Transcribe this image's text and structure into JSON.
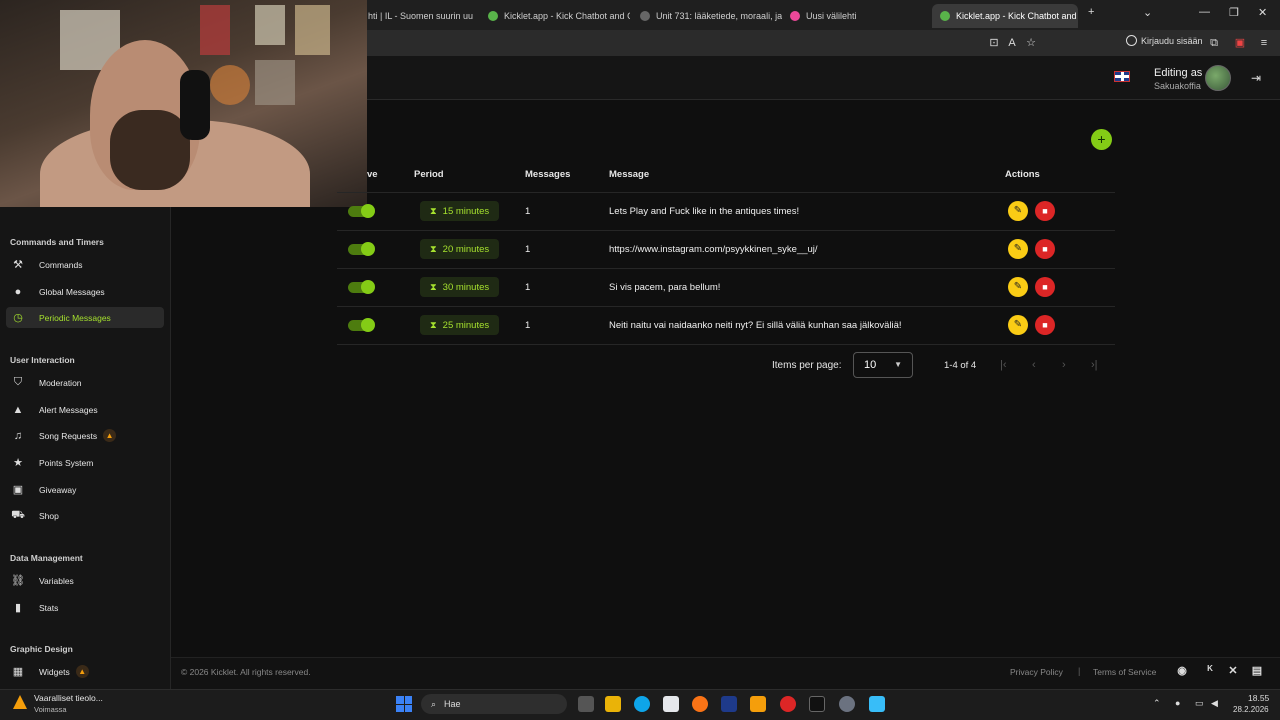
{
  "browser": {
    "tabs": [
      {
        "label": "hti | IL - Suomen suurin uu"
      },
      {
        "label": "Kicklet.app - Kick Chatbot and C"
      },
      {
        "label": "Unit 731: lääketiede, moraali, ja"
      },
      {
        "label": "Uusi välilehti"
      },
      {
        "label": "Kicklet.app - Kick Chatbot and C"
      }
    ],
    "login_label": "Kirjaudu sisään"
  },
  "header": {
    "editing_as": "Editing as",
    "username": "Sakuakoffia"
  },
  "sidebar": {
    "sections": [
      {
        "title": "Commands and Timers",
        "items": [
          {
            "label": "Commands",
            "icon": "hammer-icon"
          },
          {
            "label": "Global Messages",
            "icon": "chat-bubble-icon"
          },
          {
            "label": "Periodic Messages",
            "icon": "clock-icon",
            "active": true
          }
        ]
      },
      {
        "title": "User Interaction",
        "items": [
          {
            "label": "Moderation",
            "icon": "shield-icon"
          },
          {
            "label": "Alert Messages",
            "icon": "warning-icon"
          },
          {
            "label": "Song Requests",
            "icon": "music-note-icon",
            "badge": "fire"
          },
          {
            "label": "Points System",
            "icon": "star-icon"
          },
          {
            "label": "Giveaway",
            "icon": "gift-icon"
          },
          {
            "label": "Shop",
            "icon": "cart-icon"
          }
        ]
      },
      {
        "title": "Data Management",
        "items": [
          {
            "label": "Variables",
            "icon": "link-icon"
          },
          {
            "label": "Stats",
            "icon": "bar-chart-icon"
          }
        ]
      },
      {
        "title": "Graphic Design",
        "items": [
          {
            "label": "Widgets",
            "icon": "widgets-icon",
            "badge": "fire"
          }
        ]
      }
    ]
  },
  "table": {
    "columns": {
      "active": "ve",
      "period": "Period",
      "messages": "Messages",
      "message": "Message",
      "actions": "Actions"
    },
    "rows": [
      {
        "active": true,
        "period": "15 minutes",
        "messages": "1",
        "message": "Lets Play and Fuck like in the antiques times!"
      },
      {
        "active": true,
        "period": "20 minutes",
        "messages": "1",
        "message": "https://www.instagram.com/psyykkinen_syke__uj/"
      },
      {
        "active": true,
        "period": "30 minutes",
        "messages": "1",
        "message": "Si vis pacem, para bellum!"
      },
      {
        "active": true,
        "period": "25 minutes",
        "messages": "1",
        "message": "Neiti naitu vai naidaanko neiti nyt? Ei sillä väliä kunhan saa jälkoväliä!"
      }
    ]
  },
  "pagination": {
    "items_per_page_label": "Items per page:",
    "items_per_page_value": "10",
    "range": "1-4 of 4"
  },
  "footer": {
    "copyright": "© 2026 Kicklet. All rights reserved.",
    "privacy": "Privacy Policy",
    "separator": "|",
    "terms": "Terms of Service"
  },
  "taskbar": {
    "weather_line1": "Vaaralliset tieolo...",
    "weather_line2": "Voimassa",
    "search_placeholder": "Hae",
    "time": "18.55",
    "date": "28.2.2026"
  },
  "colors": {
    "accent": "#84cc16",
    "edit": "#facc15",
    "delete": "#dc2626"
  }
}
